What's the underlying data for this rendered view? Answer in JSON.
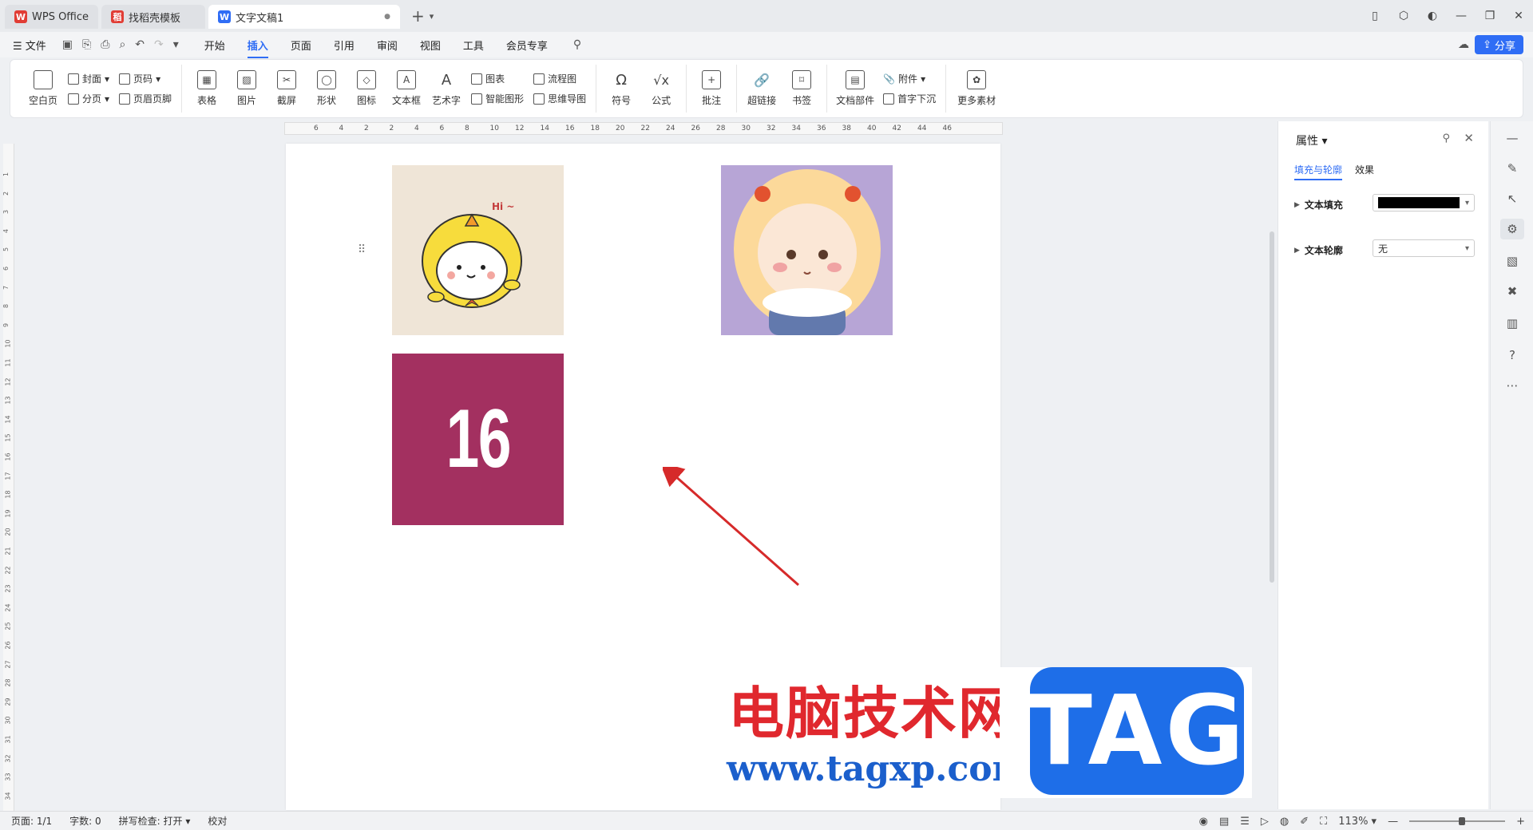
{
  "tabs": [
    {
      "label": "WPS Office",
      "color": "#e13d35"
    },
    {
      "label": "找稻壳模板",
      "color": "#e13d35"
    },
    {
      "label": "文字文稿1",
      "color": "#2f6df5",
      "dot": "●"
    }
  ],
  "tab_add": "+",
  "menu": {
    "file": "☰ 文件",
    "items": [
      "开始",
      "插入",
      "页面",
      "引用",
      "审阅",
      "视图",
      "工具",
      "会员专享"
    ],
    "active": "插入",
    "share": "分享"
  },
  "ribbon": {
    "blank_page": "空白页",
    "cover": "封面",
    "page_break": "分页",
    "page_number": "页码",
    "header_footer": "页眉页脚",
    "table": "表格",
    "picture": "图片",
    "screenshot": "截屏",
    "shape": "形状",
    "icon": "图标",
    "textbox": "文本框",
    "wordart": "艺术字",
    "chart": "图表",
    "smart_graphic": "智能图形",
    "flowchart": "流程图",
    "mindmap": "思维导图",
    "symbol": "符号",
    "formula": "公式",
    "comment": "批注",
    "hyperlink": "超链接",
    "bookmark": "书签",
    "doc_parts": "文档部件",
    "attachment": "附件",
    "drop_cap": "首字下沉",
    "more_materials": "更多素材"
  },
  "ruler_ticks": [
    "6",
    "4",
    "2",
    "2",
    "4",
    "6",
    "8",
    "10",
    "12",
    "14",
    "16",
    "18",
    "20",
    "22",
    "24",
    "26",
    "28",
    "30",
    "32",
    "34",
    "36",
    "38",
    "40",
    "42",
    "44",
    "46"
  ],
  "vruler_ticks": [
    "1",
    "2",
    "3",
    "4",
    "5",
    "6",
    "7",
    "8",
    "9",
    "10",
    "11",
    "12",
    "13",
    "14",
    "15",
    "16",
    "17",
    "18",
    "19",
    "20",
    "21",
    "22",
    "23",
    "24",
    "25",
    "26",
    "27",
    "28",
    "29",
    "30",
    "31",
    "32",
    "33",
    "34"
  ],
  "document": {
    "img1_text": "Hi ~",
    "img3_text": "16"
  },
  "watermark": {
    "cn_text": "电脑技术网",
    "url": "www.tagxp.com",
    "tag": "TAG"
  },
  "properties_panel": {
    "title": "属性",
    "tab_fill": "填充与轮廓",
    "tab_effect": "效果",
    "text_fill_label": "文本填充",
    "text_fill_color": "#000000",
    "text_outline_label": "文本轮廓",
    "text_outline_value": "无"
  },
  "statusbar": {
    "page": "页面: 1/1",
    "words": "字数: 0",
    "spell": "拼写检查: 打开",
    "proof": "校对",
    "zoom": "113%",
    "zoom_level": 0.55
  },
  "colors": {
    "accent": "#2f6df5",
    "img3_bg": "#a33060"
  }
}
